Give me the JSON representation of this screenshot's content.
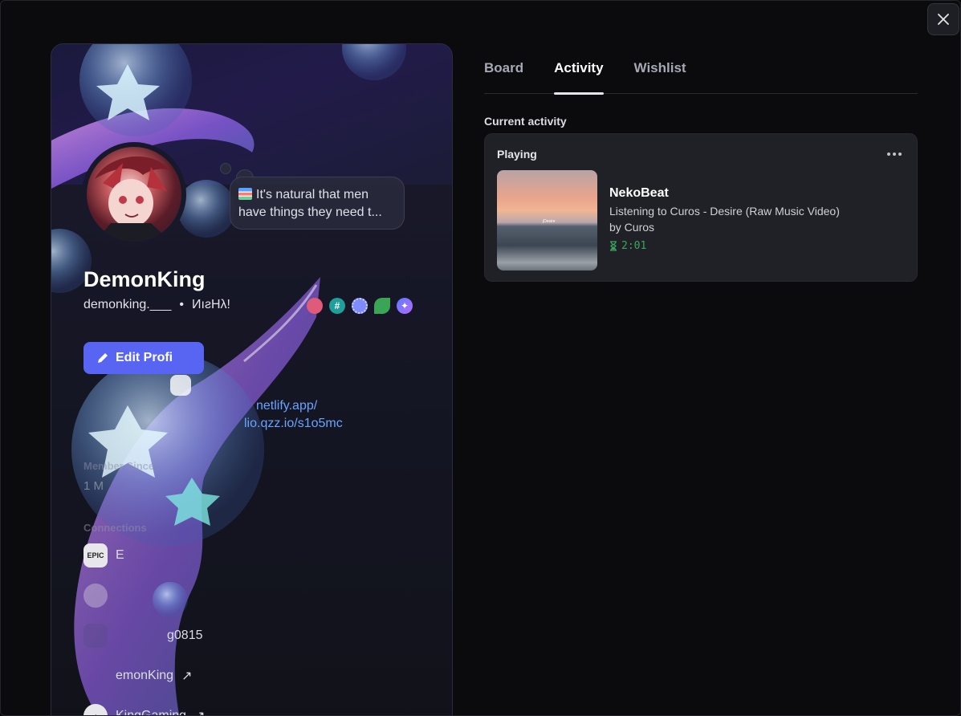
{
  "close_icon": "close-icon",
  "profile": {
    "display_name": "DemonKing",
    "username": "demonking.___",
    "separator": "•",
    "pronouns": "ИıƨНλǃ",
    "status_emoji": "books-emoji",
    "status_text": "It's natural that men have things they need t...",
    "edit_button_label": "Edit Profi",
    "links": [
      "netlify.app/",
      "lio.qzz.io/s1o5mc"
    ],
    "member_since_label": "Member Since",
    "member_since_value": "1 M",
    "connections_label": "Connections",
    "connections": [
      {
        "icon": "epic-games-icon",
        "name": "E"
      },
      {
        "icon": "github-icon",
        "name": ""
      },
      {
        "icon": "steam-icon",
        "name": "g0815"
      },
      {
        "icon": "link-icon",
        "name": "emonKing",
        "external": "↗"
      },
      {
        "icon": "tiktok-icon",
        "name": "KingGaming",
        "external": "↗"
      }
    ],
    "badges": [
      "nitro",
      "hypesquad",
      "quest",
      "leaf",
      "orbs"
    ]
  },
  "tabs": [
    {
      "label": "Board",
      "active": false
    },
    {
      "label": "Activity",
      "active": true
    },
    {
      "label": "Wishlist",
      "active": false
    }
  ],
  "activity": {
    "section_label": "Current activity",
    "heading": "Playing",
    "app_name": "NekoBeat",
    "details": "Listening to Curos - Desire (Raw Music Video)",
    "state": "by Curos",
    "elapsed": "2:01",
    "thumb_caption": "jDesire"
  },
  "colors": {
    "accent": "#5865f2",
    "elapsed_green": "#3ba55d",
    "link_blue": "#6aa3ff"
  }
}
